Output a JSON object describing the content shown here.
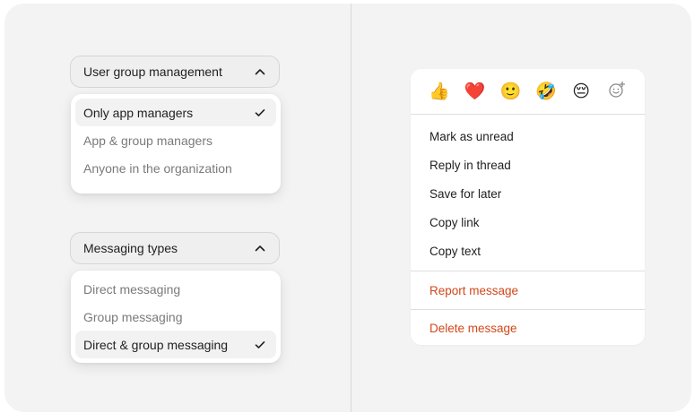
{
  "left_panel": {
    "dropdown1": {
      "trigger_label": "User group management",
      "options": [
        {
          "label": "Only app managers",
          "selected": true
        },
        {
          "label": "App & group managers",
          "selected": false
        },
        {
          "label": "Anyone in the organization",
          "selected": false
        }
      ]
    },
    "dropdown2": {
      "trigger_label": "Messaging types",
      "options": [
        {
          "label": "Direct messaging",
          "selected": false
        },
        {
          "label": "Group messaging",
          "selected": false
        },
        {
          "label": "Direct & group messaging",
          "selected": true
        }
      ]
    }
  },
  "context_menu": {
    "reactions": [
      {
        "icon": "thumbs-up-icon",
        "glyph": "👍"
      },
      {
        "icon": "heart-icon",
        "glyph": "❤️"
      },
      {
        "icon": "smile-icon",
        "glyph": "🙂"
      },
      {
        "icon": "rolling-laughing-icon",
        "glyph": "🤣"
      },
      {
        "icon": "pensive-icon",
        "glyph": "😔"
      },
      {
        "icon": "add-reaction-icon",
        "glyph": ""
      }
    ],
    "items": [
      "Mark as unread",
      "Reply in thread",
      "Save for later",
      "Copy link",
      "Copy text"
    ],
    "report_label": "Report message",
    "delete_label": "Delete message"
  },
  "colors": {
    "danger": "#d2471a",
    "background": "#f3f3f3",
    "selected_row": "#f2f2f2"
  }
}
